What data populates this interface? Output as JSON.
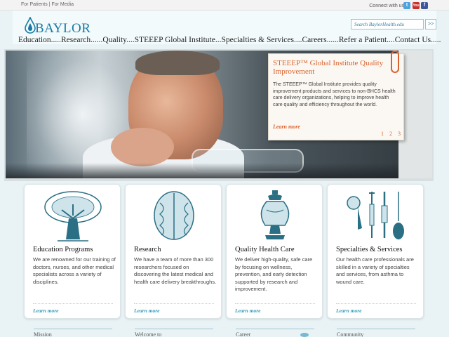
{
  "topbar": {
    "links": [
      "For Patients",
      "|",
      "For Media"
    ],
    "connect_label": "Connect with us:",
    "social": [
      {
        "name": "twitter",
        "glyph": "t",
        "color": "#4aa3df"
      },
      {
        "name": "youtube",
        "glyph": "You",
        "color": "#c4302b"
      },
      {
        "name": "facebook",
        "glyph": "f",
        "color": "#3b5998"
      }
    ]
  },
  "header": {
    "logo_text": "BAYLOR",
    "search_placeholder": "Search BaylorHealth.edu",
    "search_button": ">>"
  },
  "nav": {
    "items": [
      "Education.....",
      "Research......",
      "Quality....",
      "STEEEP Global Institute...",
      "Specialties & Services....",
      "Careers......",
      "Refer a Patient....",
      "Contact Us....."
    ]
  },
  "feature": {
    "title": "STEEEP™ Global Institute Quality Improvement",
    "body": "The STEEEP™ Global Institute provides quality improvement products and services to non-BHCS health care delivery organizations, helping to improve health care quality and efficiency throughout the world.",
    "more": "Learn more",
    "pages": [
      "1",
      "2",
      "3"
    ],
    "accent": "#d9632f"
  },
  "tiles": [
    {
      "icon": "tree-icon",
      "title": "Education Programs",
      "body": "We are renowned for our training of doctors, nurses, and other medical specialists across a variety of disciplines.",
      "more": "Learn more"
    },
    {
      "icon": "brain-icon",
      "title": "Research",
      "body": "We have a team of more than 300 researchers focused on discovering the latest medical and health care delivery breakthroughs.",
      "more": "Learn more"
    },
    {
      "icon": "urn-icon",
      "title": "Quality Health Care",
      "body": "We deliver high-quality, safe care by focusing on wellness, prevention, and early detection supported by research and improvement.",
      "more": "Learn more"
    },
    {
      "icon": "medical-instruments-icon",
      "title": "Specialties & Services",
      "body": "Our health care professionals are skilled in a variety of specialties and services, from asthma to wound care.",
      "more": "Learn more"
    }
  ],
  "bottom": {
    "items": [
      "Mission",
      "Welcome to",
      "Career",
      "Community"
    ]
  },
  "colors": {
    "link_blue": "#2d98b6",
    "logo_blue": "#1a7aa6",
    "background": "#e9f3f5"
  }
}
